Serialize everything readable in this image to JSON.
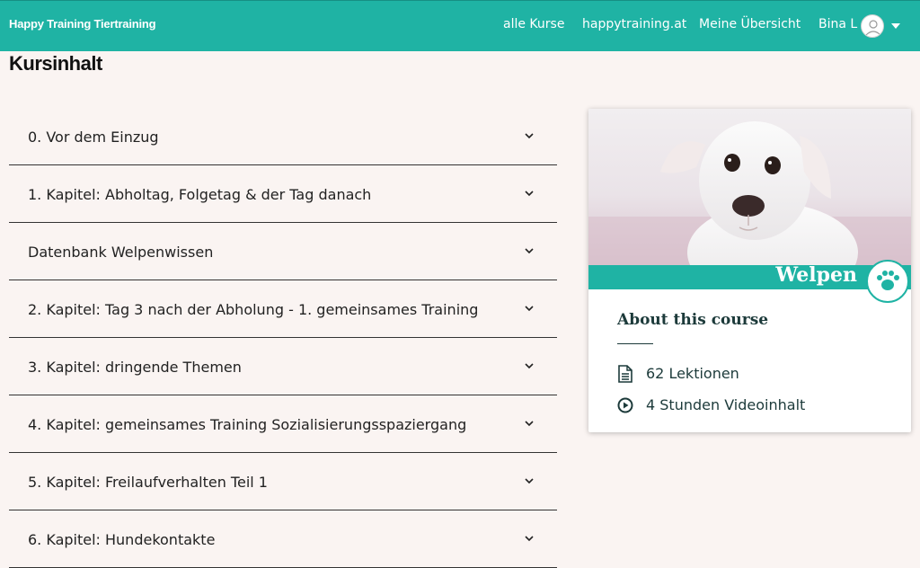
{
  "navbar": {
    "brand": "Happy Training Tiertraining",
    "links": [
      "alle Kurse",
      "happytraining.at",
      "Meine Übersicht"
    ],
    "user_name": "Bina L",
    "bg_color": "#1fb3a4"
  },
  "page": {
    "heading": "Kursinhalt"
  },
  "chapters": [
    {
      "title": "0. Vor dem Einzug"
    },
    {
      "title": "1. Kapitel: Abholtag, Folgetag & der Tag danach"
    },
    {
      "title": "Datenbank Welpenwissen"
    },
    {
      "title": "2. Kapitel: Tag 3 nach der Abholung - 1. gemeinsames Training"
    },
    {
      "title": "3. Kapitel: dringende Themen"
    },
    {
      "title": "4. Kapitel: gemeinsames Training Sozialisierungsspaziergang"
    },
    {
      "title": "5. Kapitel: Freilaufverhalten Teil 1"
    },
    {
      "title": "6. Kapitel: Hundekontakte"
    }
  ],
  "course_card": {
    "banner_text": "Welpen",
    "about_title": "About this course",
    "lessons": "62 Lektionen",
    "video": "4 Stunden Videoinhalt",
    "icons": [
      "document-icon",
      "play-circle-icon"
    ]
  }
}
